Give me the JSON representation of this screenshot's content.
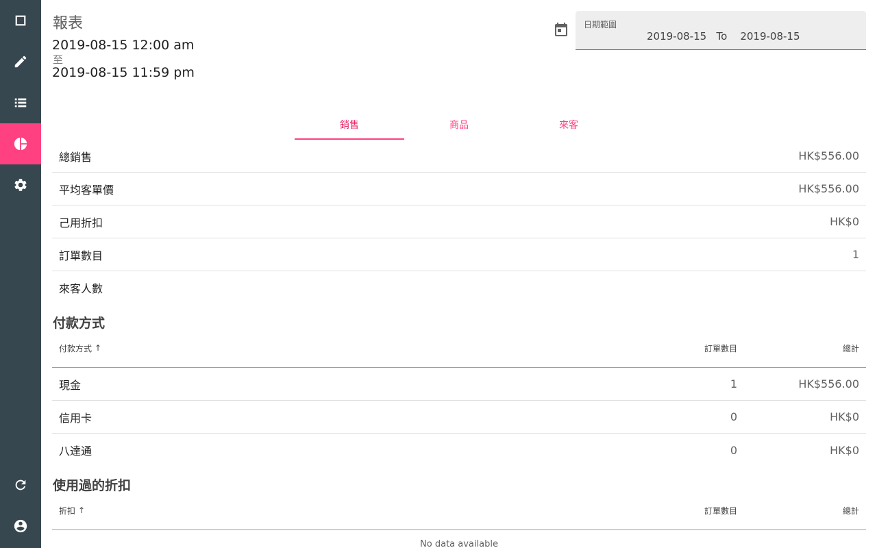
{
  "sidebar": {
    "items": [
      {
        "name": "nav-square",
        "icon": "square-icon"
      },
      {
        "name": "nav-edit",
        "icon": "pencil-icon"
      },
      {
        "name": "nav-list",
        "icon": "list-icon"
      },
      {
        "name": "nav-reports",
        "icon": "pie-chart-icon",
        "active": true
      },
      {
        "name": "nav-settings",
        "icon": "gear-icon"
      }
    ],
    "bottom_items": [
      {
        "name": "nav-refresh",
        "icon": "refresh-icon"
      },
      {
        "name": "nav-account",
        "icon": "account-circle-icon"
      }
    ],
    "colors": {
      "background": "#37474f",
      "active": "#ff4081"
    }
  },
  "header": {
    "title": "報表",
    "range_from": "2019-08-15 12:00 am",
    "range_sep": "至",
    "range_to": "2019-08-15 11:59 pm"
  },
  "date_range": {
    "label": "日期範圍",
    "value": "2019-08-15   To    2019-08-15"
  },
  "tabs": [
    {
      "label": "銷售",
      "active": true
    },
    {
      "label": "商品"
    },
    {
      "label": "來客"
    }
  ],
  "summary": [
    {
      "label": "總銷售",
      "value": "HK$556.00"
    },
    {
      "label": "平均客單價",
      "value": "HK$556.00"
    },
    {
      "label": "己用折扣",
      "value": "HK$0"
    },
    {
      "label": "訂單數目",
      "value": "1"
    },
    {
      "label": "來客人數",
      "value": ""
    }
  ],
  "payment": {
    "title": "付款方式",
    "headers": {
      "method": "付款方式",
      "orders": "訂單數目",
      "total": "總計"
    },
    "sort_icon": "↑",
    "rows": [
      {
        "method": "現金",
        "orders": "1",
        "total": "HK$556.00"
      },
      {
        "method": "信用卡",
        "orders": "0",
        "total": "HK$0"
      },
      {
        "method": "八達通",
        "orders": "0",
        "total": "HK$0"
      }
    ]
  },
  "discounts": {
    "title": "使用過的折扣",
    "headers": {
      "discount": "折扣",
      "orders": "訂單數目",
      "total": "總計"
    },
    "sort_icon": "↑",
    "empty_text": "No data available"
  },
  "accent_color": "#ff4081"
}
